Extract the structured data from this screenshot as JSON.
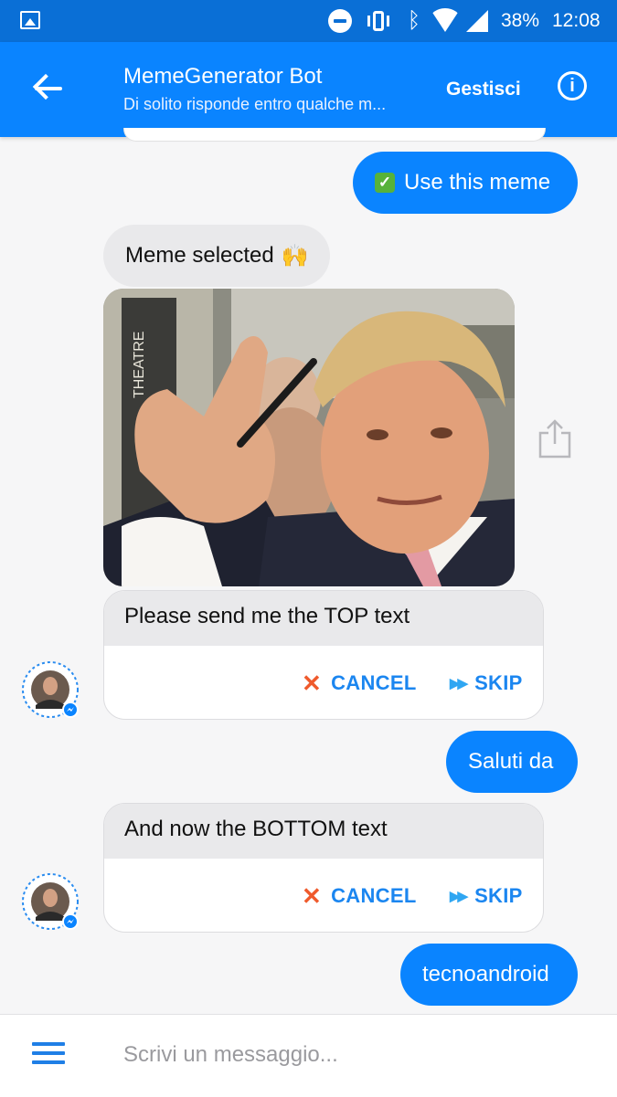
{
  "status_bar": {
    "battery": "38%",
    "time": "12:08"
  },
  "header": {
    "title": "MemeGenerator Bot",
    "subtitle": "Di solito risponde entro qualche m...",
    "manage_label": "Gestisci",
    "info_label": "i"
  },
  "messages": {
    "use_meme": "Use this meme",
    "meme_selected": "Meme selected",
    "top_prompt": "Please send me the TOP text",
    "reply_top": "Saluti da",
    "bottom_prompt": "And now the BOTTOM text",
    "reply_bottom": "tecnoandroid"
  },
  "actions": {
    "cancel": "CANCEL",
    "skip": "SKIP"
  },
  "composer": {
    "placeholder": "Scrivi un messaggio..."
  },
  "colors": {
    "brand": "#0a84ff",
    "status_bar": "#0a6fd6",
    "cancel_icon": "#ef5a2c",
    "action_text": "#1b86f0"
  }
}
